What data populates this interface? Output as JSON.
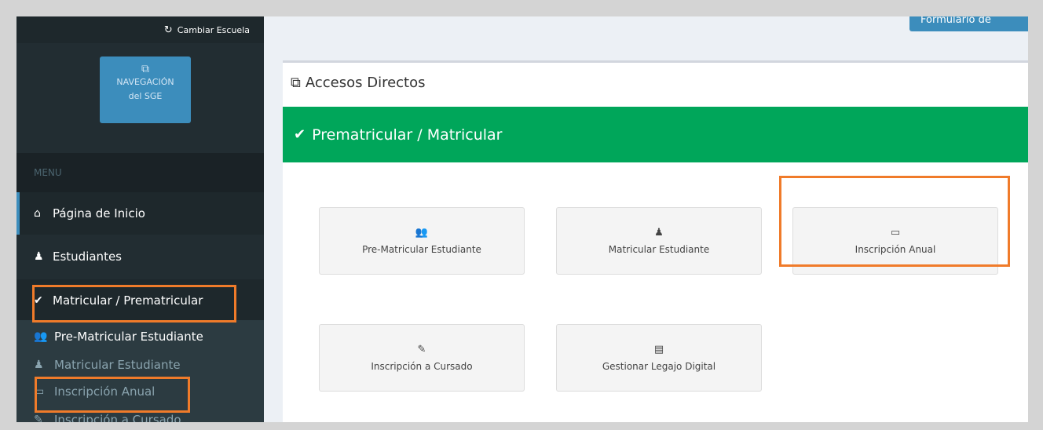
{
  "sidebar": {
    "switch_school": "Cambiar Escuela",
    "nav_button": {
      "line1": "NAVEGACIÓN",
      "line2": "del SGE",
      "icon": "external-link-icon"
    },
    "menu_header": "MENU",
    "items": [
      {
        "label": "Página de Inicio",
        "icon": "home-icon"
      },
      {
        "label": "Estudiantes",
        "icon": "male-icon"
      },
      {
        "label": "Matricular / Prematricular",
        "icon": "check-icon"
      }
    ],
    "submenu": [
      {
        "label": "Pre-Matricular Estudiante",
        "icon": "user-plus-icon"
      },
      {
        "label": "Matricular Estudiante",
        "icon": "male-icon"
      },
      {
        "label": "Inscripción Anual",
        "icon": "calendar-icon"
      },
      {
        "label": "Inscripción a Cursado",
        "icon": "pencil-icon"
      }
    ]
  },
  "main": {
    "top_button": "Formulario de",
    "box_title": "Accesos Directos",
    "banner_title": "Prematricular / Matricular",
    "cards": [
      {
        "label": "Pre-Matricular Estudiante",
        "icon": "user-plus-icon"
      },
      {
        "label": "Matricular Estudiante",
        "icon": "male-icon"
      },
      {
        "label": "Inscripción Anual",
        "icon": "calendar-icon"
      },
      {
        "label": "Inscripción a Cursado",
        "icon": "pencil-icon"
      },
      {
        "label": "Gestionar Legajo Digital",
        "icon": "id-card-icon"
      }
    ]
  },
  "colors": {
    "sidebar_bg": "#222d32",
    "accent_blue": "#3c8dbc",
    "banner_green": "#00a65a",
    "highlight_orange": "#f07b2a"
  }
}
